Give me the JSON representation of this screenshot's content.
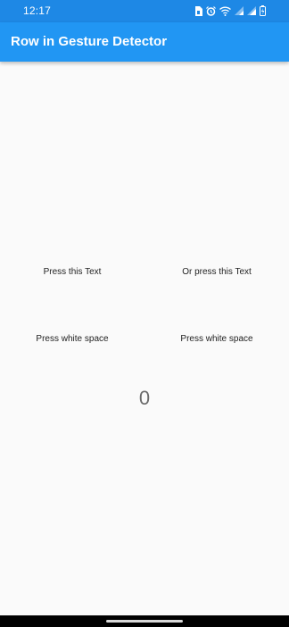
{
  "status_bar": {
    "time": "12:17",
    "icons": [
      "sim-icon",
      "alarm-icon",
      "wifi-icon",
      "signal-icon",
      "signal-icon",
      "battery-icon"
    ]
  },
  "app_bar": {
    "title": "Row in Gesture Detector"
  },
  "rows": [
    {
      "left": "Press this Text",
      "right": "Or press this Text"
    },
    {
      "left": "Press white space",
      "right": "Press white space"
    }
  ],
  "counter": "0",
  "colors": {
    "app_bar": "#2196f3",
    "status_bar": "#1e88e5",
    "background": "#fafafa"
  }
}
